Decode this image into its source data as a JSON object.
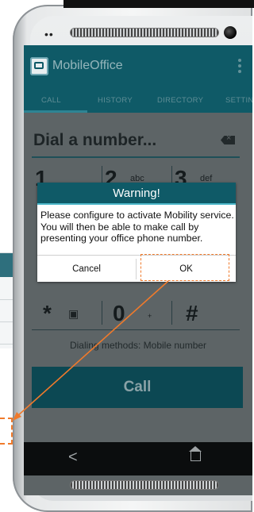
{
  "app": {
    "title": "MobileOffice",
    "brand_color": "#0f5a67",
    "accent_color": "#4cb7c9",
    "highlight_color": "#f07a2b"
  },
  "tabs": [
    {
      "label": "CALL"
    },
    {
      "label": "HISTORY"
    },
    {
      "label": "DIRECTORY"
    },
    {
      "label": "SETTIN"
    }
  ],
  "dialer": {
    "placeholder": "Dial a number...",
    "keys": [
      {
        "digit": "1",
        "letters": ""
      },
      {
        "digit": "2",
        "letters": "abc"
      },
      {
        "digit": "3",
        "letters": "def"
      },
      {
        "digit": "*",
        "letters": ""
      },
      {
        "digit": "0",
        "letters": "+"
      },
      {
        "digit": "#",
        "letters": ""
      }
    ],
    "dialing_methods": "Dialing methods: Mobile number",
    "call_label": "Call"
  },
  "dialog": {
    "title": "Warning!",
    "message": "Please configure to activate Mobility service. You will then be able to make call by presenting your office phone number.",
    "cancel_label": "Cancel",
    "ok_label": "OK"
  },
  "nav": {
    "back_glyph": "<"
  }
}
